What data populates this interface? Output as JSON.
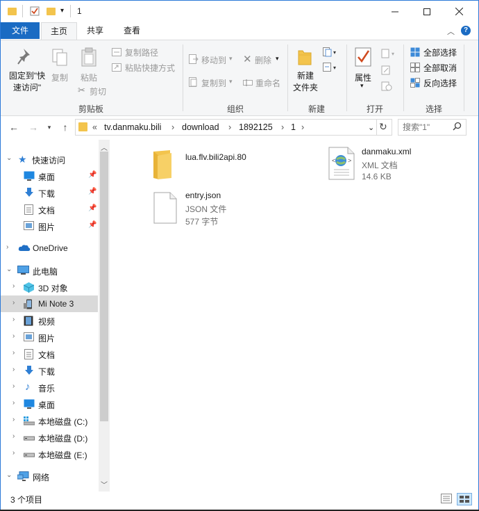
{
  "window": {
    "title": "1"
  },
  "tabs": [
    {
      "label": "文件"
    },
    {
      "label": "主页"
    },
    {
      "label": "共享"
    },
    {
      "label": "查看"
    }
  ],
  "ribbon": {
    "clipboard": {
      "pin_label": "固定到\"快\n速访问\"",
      "copy_label": "复制",
      "paste_label": "粘贴",
      "copy_path_label": "复制路径",
      "paste_shortcut_label": "粘贴快捷方式",
      "cut_label": "剪切",
      "group_label": "剪贴板"
    },
    "organize": {
      "move_to_label": "移动到",
      "copy_to_label": "复制到",
      "delete_label": "删除",
      "rename_label": "重命名",
      "group_label": "组织"
    },
    "new": {
      "new_folder_label": "新建\n文件夹",
      "group_label": "新建"
    },
    "open": {
      "properties_label": "属性",
      "group_label": "打开"
    },
    "select": {
      "select_all_label": "全部选择",
      "select_none_label": "全部取消",
      "invert_label": "反向选择",
      "group_label": "选择"
    }
  },
  "address": {
    "overflow": "«",
    "crumbs": [
      "tv.danmaku.bili",
      "download",
      "1892125",
      "1"
    ]
  },
  "search": {
    "placeholder": "搜索\"1\""
  },
  "nav": {
    "quick_access": "快速访问",
    "qa_items": [
      "桌面",
      "下载",
      "文档",
      "图片"
    ],
    "onedrive": "OneDrive",
    "this_pc": "此电脑",
    "pc_items": [
      "3D 对象",
      "Mi Note 3",
      "视频",
      "图片",
      "文档",
      "下载",
      "音乐",
      "桌面",
      "本地磁盘 (C:)",
      "本地磁盘 (D:)",
      "本地磁盘 (E:)"
    ],
    "network": "网络"
  },
  "files": [
    {
      "name": "lua.flv.bili2api.80",
      "type": "",
      "size": ""
    },
    {
      "name": "danmaku.xml",
      "type": "XML 文档",
      "size": "14.6 KB"
    },
    {
      "name": "entry.json",
      "type": "JSON 文件",
      "size": "577 字节"
    }
  ],
  "status": {
    "count": "3 个项目"
  },
  "colors": {
    "accent": "#1a6bc3",
    "folder": "#f3c44d",
    "selection": "#cce8ff"
  }
}
